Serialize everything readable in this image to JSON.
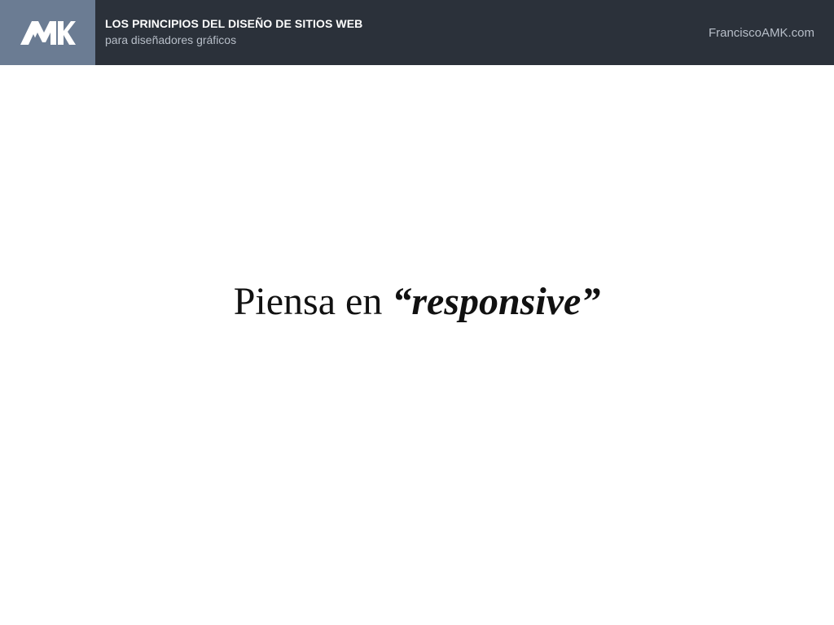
{
  "header": {
    "logo_text": "AMK",
    "title": "LOS PRINCIPIOS DEL DISEÑO DE SITIOS WEB",
    "subtitle": "para diseñadores gráficos",
    "site": "FranciscoAMK.com"
  },
  "slide": {
    "text_plain": "Piensa en ",
    "text_emphasis": "“responsive”"
  },
  "colors": {
    "header_bg": "#2b313a",
    "logo_bg": "#6b7c93",
    "background": "#ffffff"
  }
}
